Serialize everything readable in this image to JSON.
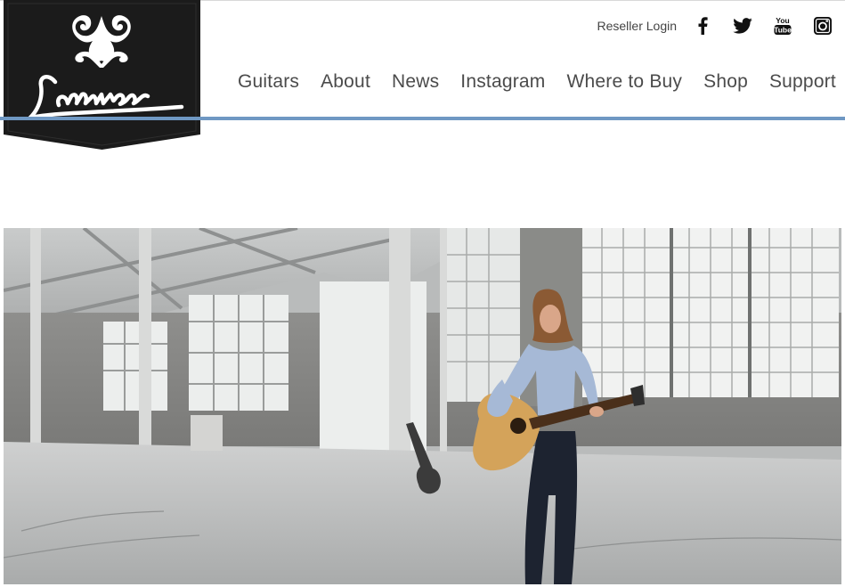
{
  "brand": {
    "name": "Larrivée"
  },
  "utility": {
    "reseller_login": "Reseller Login",
    "social": [
      {
        "icon": "facebook-icon"
      },
      {
        "icon": "twitter-icon"
      },
      {
        "icon": "youtube-icon",
        "label": "You Tube"
      },
      {
        "icon": "instagram-icon"
      }
    ]
  },
  "nav": {
    "items": [
      {
        "label": "Guitars"
      },
      {
        "label": "About"
      },
      {
        "label": "News"
      },
      {
        "label": "Instagram"
      },
      {
        "label": "Where to Buy"
      },
      {
        "label": "Shop"
      },
      {
        "label": "Support"
      }
    ]
  },
  "colors": {
    "accent": "#6f98c3",
    "logo_bg": "#1a1a1a",
    "text": "#4b4b4b"
  }
}
